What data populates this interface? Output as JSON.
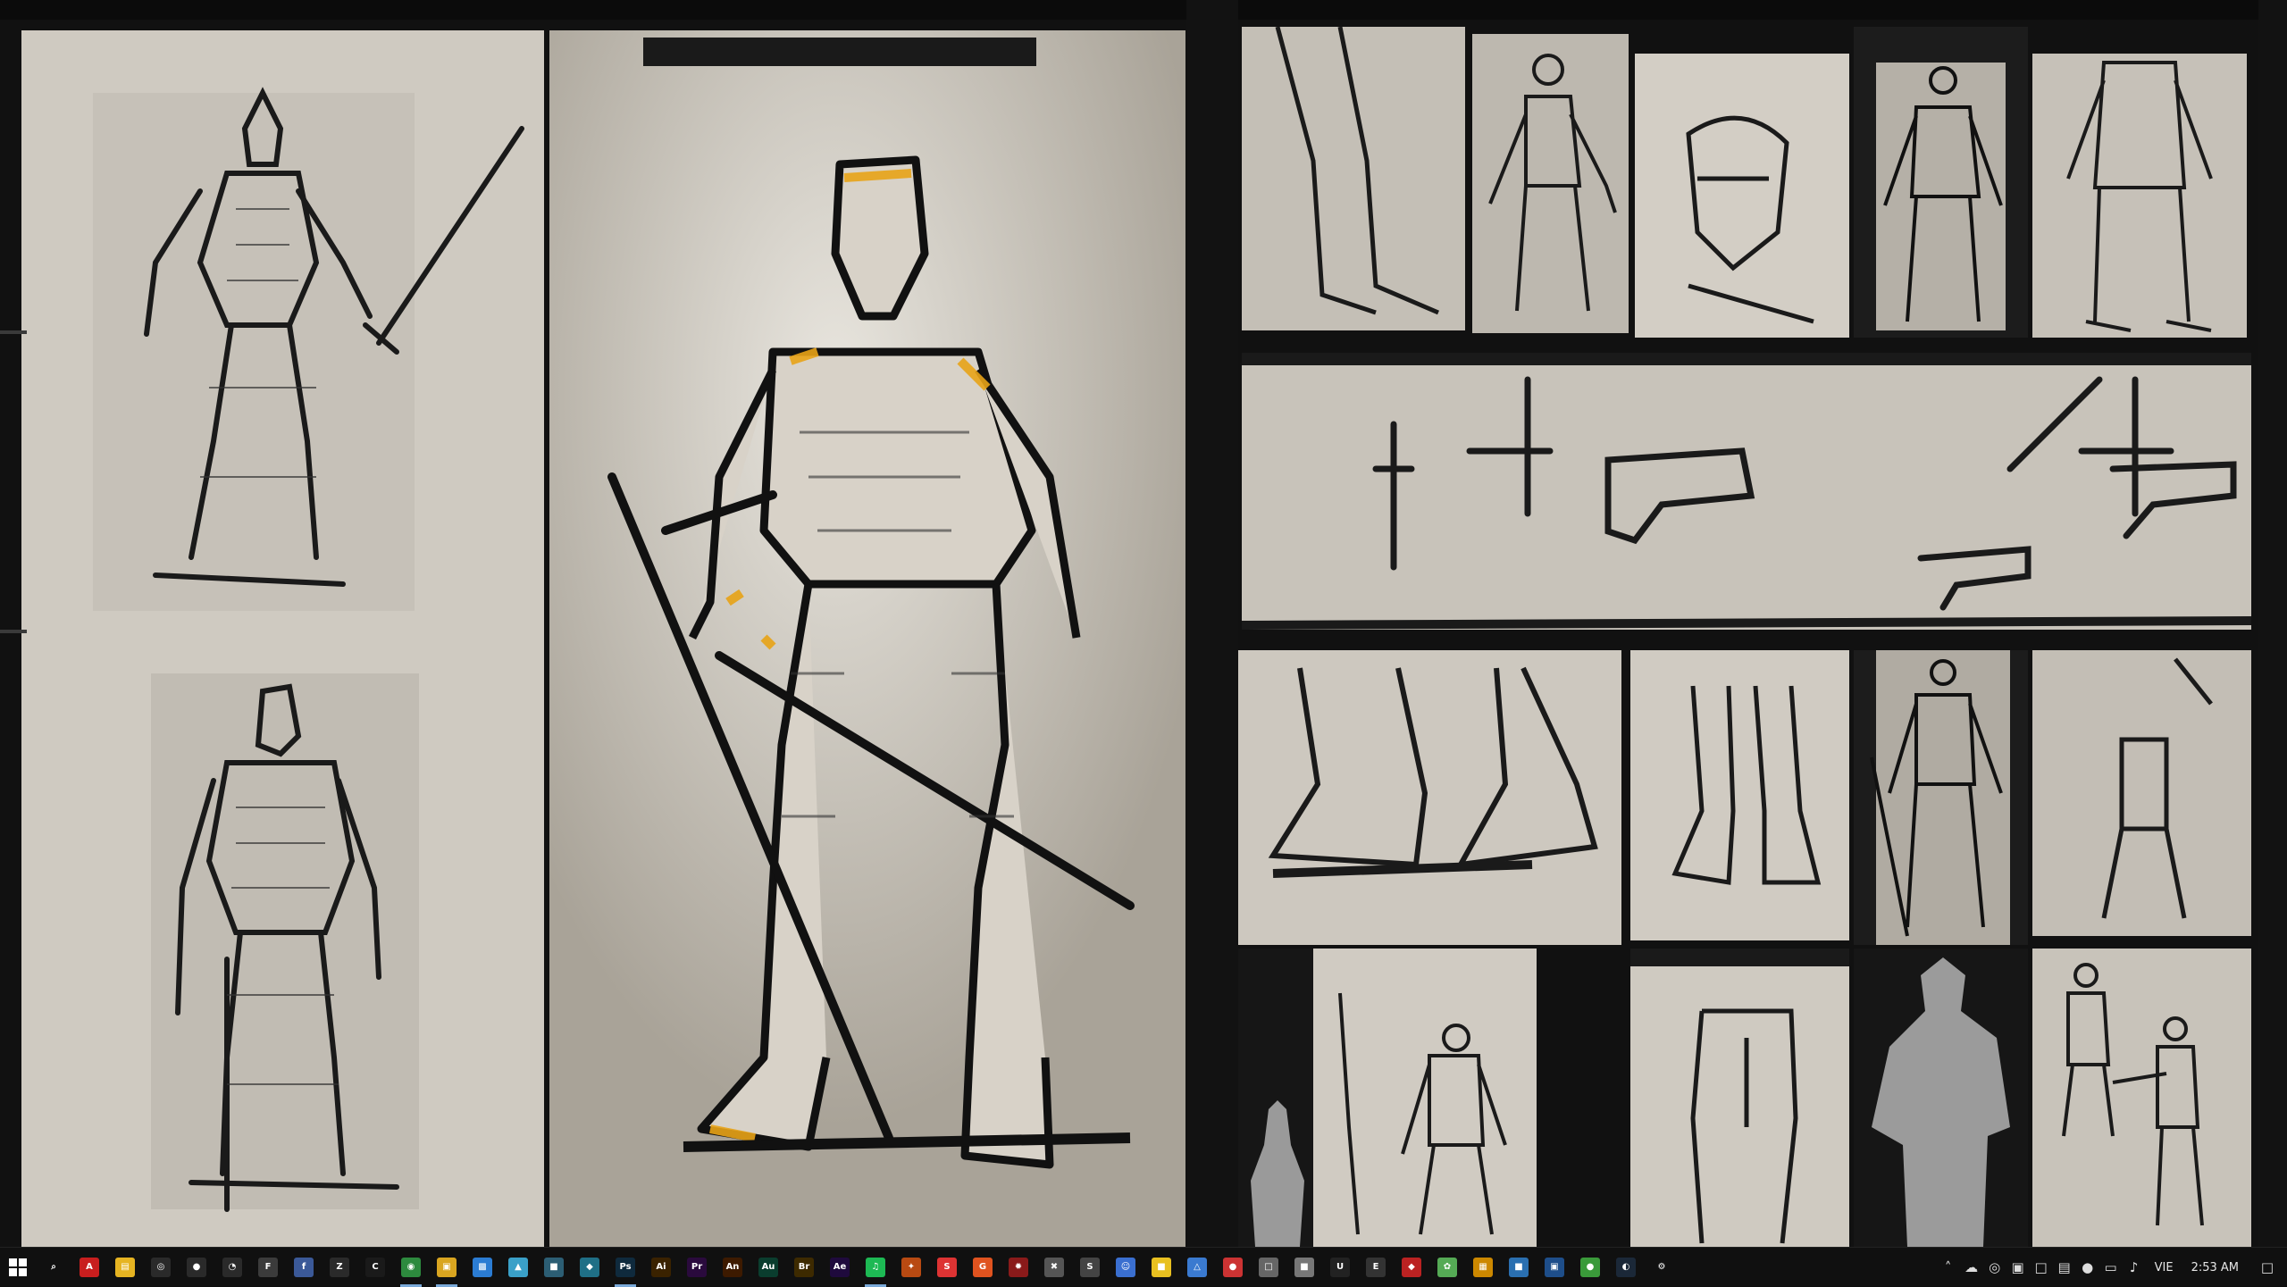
{
  "desktop": {
    "title_bar_text": ""
  },
  "taskbar": {
    "start_icon": "windows-logo-icon",
    "apps": [
      {
        "name": "search",
        "icon": "search-icon",
        "glyph": "⌕",
        "color": "#101010"
      },
      {
        "name": "acrobat",
        "icon": "acrobat-icon",
        "glyph": "A",
        "color": "#c81e1e"
      },
      {
        "name": "file-explorer",
        "icon": "folder-icon",
        "glyph": "▤",
        "color": "#e6b422"
      },
      {
        "name": "obs",
        "icon": "obs-icon",
        "glyph": "◎",
        "color": "#2a2a2a"
      },
      {
        "name": "app-red",
        "icon": "record-icon",
        "glyph": "●",
        "color": "#2a2a2a"
      },
      {
        "name": "chrome-alt",
        "icon": "browser-icon",
        "glyph": "◔",
        "color": "#2a2a2a"
      },
      {
        "name": "fusion",
        "icon": "fusion-icon",
        "glyph": "F",
        "color": "#3b3b3b"
      },
      {
        "name": "facebook",
        "icon": "facebook-icon",
        "glyph": "f",
        "color": "#3b5998"
      },
      {
        "name": "zbrush",
        "icon": "zbrush-icon",
        "glyph": "Z",
        "color": "#2a2a2a"
      },
      {
        "name": "cinema",
        "icon": "cinema-icon",
        "glyph": "C",
        "color": "#1a1a1a"
      },
      {
        "name": "chrome",
        "icon": "chrome-icon",
        "glyph": "◉",
        "color": "#2d8a3e",
        "active": true
      },
      {
        "name": "folder",
        "icon": "folder-open-icon",
        "glyph": "▣",
        "color": "#d9a520",
        "active": true
      },
      {
        "name": "photos",
        "icon": "photos-icon",
        "glyph": "▩",
        "color": "#2b7cd3"
      },
      {
        "name": "paint",
        "icon": "paint-icon",
        "glyph": "▲",
        "color": "#3aa0c8"
      },
      {
        "name": "xd",
        "icon": "xd-icon",
        "glyph": "■",
        "color": "#2c5e74"
      },
      {
        "name": "sketch",
        "icon": "sketch-icon",
        "glyph": "◆",
        "color": "#1f6f86"
      },
      {
        "name": "photoshop",
        "icon": "photoshop-icon",
        "glyph": "Ps",
        "color": "#0f2a3d",
        "active": true
      },
      {
        "name": "illustrator",
        "icon": "illustrator-icon",
        "glyph": "Ai",
        "color": "#3a2200"
      },
      {
        "name": "premiere",
        "icon": "premiere-icon",
        "glyph": "Pr",
        "color": "#2a0a3d"
      },
      {
        "name": "animate",
        "icon": "animate-icon",
        "glyph": "An",
        "color": "#3d1a00"
      },
      {
        "name": "audition",
        "icon": "audition-icon",
        "glyph": "Au",
        "color": "#0a3d2e"
      },
      {
        "name": "bridge",
        "icon": "bridge-icon",
        "glyph": "Br",
        "color": "#3d2a00"
      },
      {
        "name": "after-effects",
        "icon": "after-effects-icon",
        "glyph": "Ae",
        "color": "#1f0a3d"
      },
      {
        "name": "spotify",
        "icon": "spotify-icon",
        "glyph": "♫",
        "color": "#1db954",
        "active": true
      },
      {
        "name": "game",
        "icon": "game-icon",
        "glyph": "✦",
        "color": "#b84a12"
      },
      {
        "name": "app-s",
        "icon": "s-icon",
        "glyph": "S",
        "color": "#d33"
      },
      {
        "name": "app-shield",
        "icon": "shield-icon",
        "glyph": "G",
        "color": "#e0531f"
      },
      {
        "name": "app-red2",
        "icon": "red-app-icon",
        "glyph": "✹",
        "color": "#8a1a1a"
      },
      {
        "name": "app-x",
        "icon": "x-app-icon",
        "glyph": "✖",
        "color": "#555"
      },
      {
        "name": "app-s2",
        "icon": "s-brush-icon",
        "glyph": "S",
        "color": "#444"
      },
      {
        "name": "app-ghost",
        "icon": "ghost-icon",
        "glyph": "☺",
        "color": "#3a6fd0"
      },
      {
        "name": "app-yellow",
        "icon": "notes-icon",
        "glyph": "■",
        "color": "#e8c020"
      },
      {
        "name": "app-map",
        "icon": "map-icon",
        "glyph": "△",
        "color": "#3a7ad0"
      },
      {
        "name": "app-red3",
        "icon": "red-circle-icon",
        "glyph": "●",
        "color": "#c33"
      },
      {
        "name": "app-gray",
        "icon": "box-icon",
        "glyph": "□",
        "color": "#666"
      },
      {
        "name": "app-gray2",
        "icon": "disk-icon",
        "glyph": "■",
        "color": "#777"
      },
      {
        "name": "unreal",
        "icon": "unreal-icon",
        "glyph": "U",
        "color": "#222"
      },
      {
        "name": "epic",
        "icon": "epic-icon",
        "glyph": "E",
        "color": "#333"
      },
      {
        "name": "app-shield2",
        "icon": "red-shield-icon",
        "glyph": "◆",
        "color": "#b22"
      },
      {
        "name": "app-color",
        "icon": "color-wheel-icon",
        "glyph": "✿",
        "color": "#5a5"
      },
      {
        "name": "app-multi",
        "icon": "multi-icon",
        "glyph": "▦",
        "color": "#c80"
      },
      {
        "name": "app-cloud",
        "icon": "cloud-icon",
        "glyph": "■",
        "color": "#2a6fb0"
      },
      {
        "name": "app-blue",
        "icon": "blue-app-icon",
        "glyph": "▣",
        "color": "#1e4e8a"
      },
      {
        "name": "app-green",
        "icon": "green-app-icon",
        "glyph": "●",
        "color": "#3a9a3a"
      },
      {
        "name": "steam",
        "icon": "steam-icon",
        "glyph": "◐",
        "color": "#1b2838"
      },
      {
        "name": "settings",
        "icon": "gear-icon",
        "glyph": "⚙",
        "color": "#101010"
      }
    ],
    "tray": {
      "icons": [
        {
          "name": "chevron-up-icon",
          "glyph": "˄"
        },
        {
          "name": "onedrive-icon",
          "glyph": "☁"
        },
        {
          "name": "app-tray1-icon",
          "glyph": "◎"
        },
        {
          "name": "app-tray2-icon",
          "glyph": "▣"
        },
        {
          "name": "app-tray3-icon",
          "glyph": "□"
        },
        {
          "name": "app-tray4-icon",
          "glyph": "▤"
        },
        {
          "name": "app-tray5-icon",
          "glyph": "●"
        },
        {
          "name": "network-icon",
          "glyph": "▭"
        },
        {
          "name": "volume-icon",
          "glyph": "♪"
        }
      ],
      "language": "VIE",
      "time": "2:53 AM",
      "notification_icon": "notification-icon"
    }
  }
}
